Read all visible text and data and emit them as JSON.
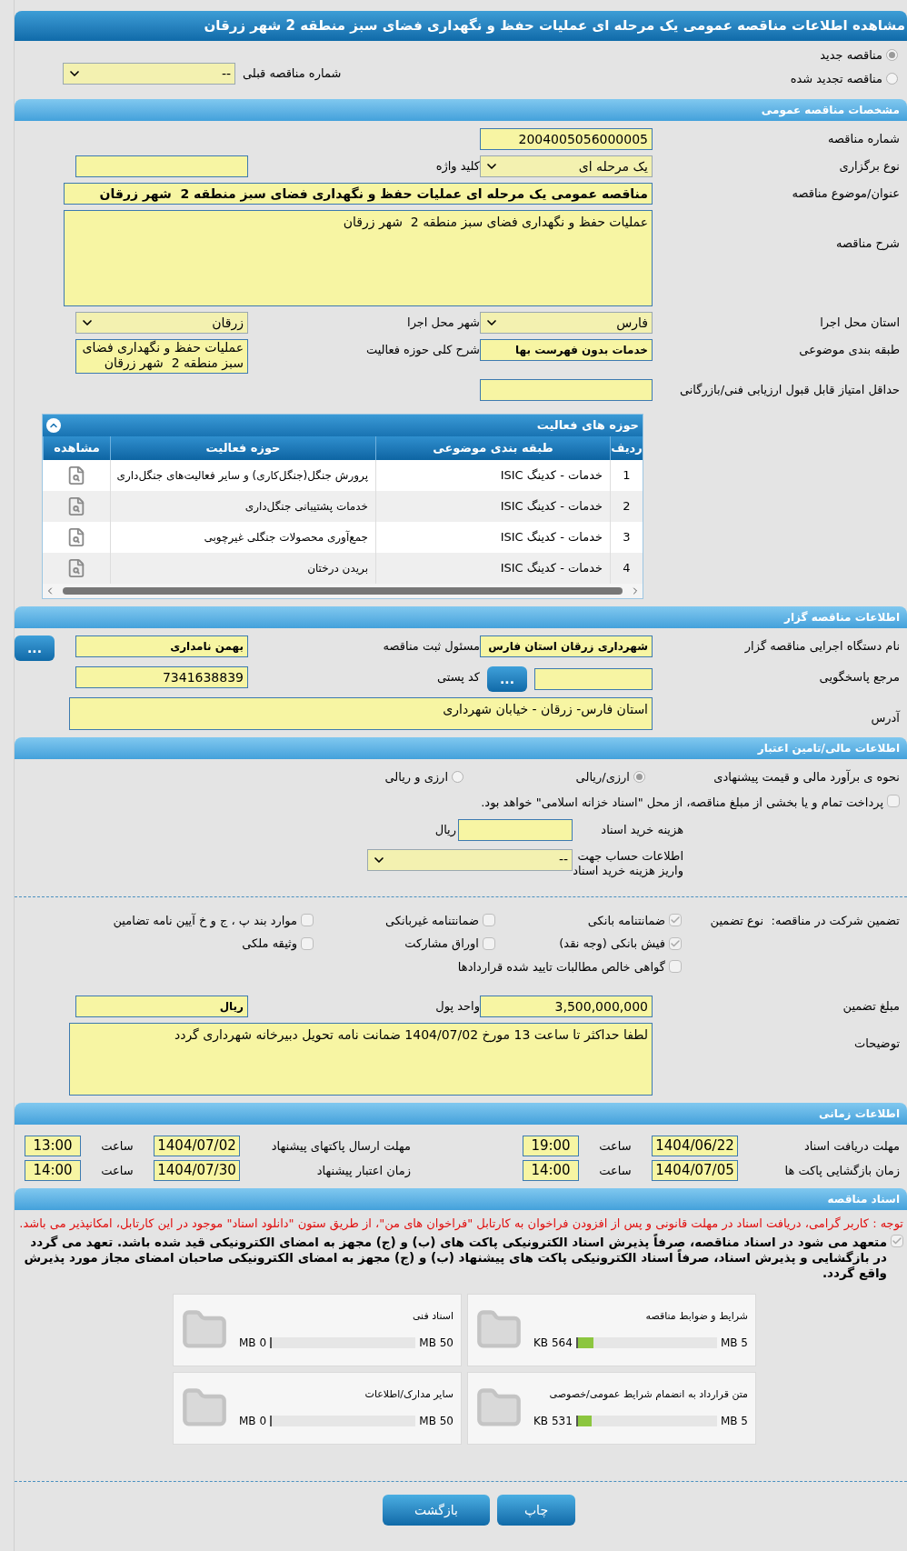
{
  "title": "مشاهده اطلاعات مناقصه عمومی یک مرحله ای عملیات حفظ و نگهداری فضای سبز منطقه 2 شهر زرقان",
  "tender_type": [
    {
      "label": "مناقصه جدید",
      "selected": true
    },
    {
      "label": "مناقصه تجدید شده",
      "selected": false
    }
  ],
  "previous_tender": {
    "label": "شماره مناقصه قبلی",
    "value": "--"
  },
  "general": {
    "heading": "مشخصات مناقصه عمومی",
    "rows": [
      [
        {
          "label": "شماره مناقصه",
          "kind": "input",
          "value": "2004005056000005",
          "bold": false
        }
      ],
      [
        {
          "label": "نوع برگزاری",
          "kind": "select",
          "value": "یک مرحله ای",
          "bold": false
        },
        {
          "label": "کلید واژه",
          "kind": "input"
        }
      ],
      [
        {
          "label": "عنوان/موضوع مناقصه",
          "kind": "wide",
          "value": "مناقصه عمومی یک مرحله ای عملیات حفظ و نگهداری فضای سبز منطقه 2  شهر زرقان",
          "bold": true
        }
      ],
      [
        {
          "label": "شرح مناقصه",
          "kind": "wide_area",
          "value": "عملیات حفظ و نگهداری فضای سبز منطقه 2  شهر زرقان",
          "bold": false
        }
      ],
      [
        {
          "label": "استان محل اجرا",
          "kind": "select",
          "value": "فارس",
          "bold": false
        },
        {
          "label": "شهر محل اجرا",
          "kind": "select",
          "value": "زرقان",
          "bold": false
        }
      ],
      [
        {
          "label": "طبقه بندی موضوعی",
          "kind": "input",
          "value": "خدمات بدون فهرست بها",
          "bold": true
        },
        {
          "label": "شرح کلی حوزه فعالیت",
          "kind": "note",
          "value": "عملیات حفظ و نگهداری فضای سبز منطقه 2  شهر زرقان",
          "bold": false
        }
      ],
      [
        {
          "label": "حداقل امتیاز قابل قبول ارزیابی فنی/بازرگانی",
          "kind": "input"
        }
      ]
    ]
  },
  "activities": {
    "heading": "حوزه های فعالیت",
    "columns": [
      "ردیف",
      "طبقه بندی موضوعی",
      "حوزه فعالیت",
      "مشاهده"
    ],
    "rows": [
      {
        "number": "1",
        "category": "خدمات - کدینگ ISIC",
        "activity": "پرورش جنگل(جنگل‌کاری) و سایر فعالیت‌های جنگل‌داری"
      },
      {
        "number": "2",
        "category": "خدمات - کدینگ ISIC",
        "activity": "خدمات پشتیبانی جنگل‌داری"
      },
      {
        "number": "3",
        "category": "خدمات - کدینگ ISIC",
        "activity": "جمع‌آوری محصولات جنگلی غیرچوبی"
      },
      {
        "number": "4",
        "category": "خدمات - کدینگ ISIC",
        "activity": "بریدن درختان"
      }
    ]
  },
  "organizer": {
    "heading": "اطلاعات مناقصه گزار",
    "rows": [
      [
        {
          "label": "نام دستگاه اجرایی مناقصه گزار",
          "kind": "input",
          "value": "شهرداری زرقان استان فارس",
          "bold": true
        },
        {
          "label": "مسئول ثبت مناقصه",
          "kind": "input",
          "value": "بهمن نامداری",
          "bold": true,
          "button": "..."
        }
      ],
      [
        {
          "label": "مرجع پاسخگویی",
          "kind": "input",
          "button": "..."
        },
        {
          "label": "کد پستی",
          "kind": "input",
          "value": "7341638839",
          "bold": false
        }
      ],
      [
        {
          "label": "آدرس",
          "kind": "wide_area",
          "value": "استان فارس- زرقان - خیابان شهرداری",
          "bold": false
        }
      ]
    ]
  },
  "finance": {
    "heading": "اطلاعات مالی/تامین اعتبار",
    "estimate": {
      "label": "نحوه ی برآورد مالی و قیمت پیشنهادی",
      "options": [
        {
          "label": "ارزی/ریالی",
          "selected": true
        },
        {
          "label": "ارزی و ریالی",
          "selected": false
        }
      ]
    },
    "treasury": {
      "label": "پرداخت تمام و یا بخشی از مبلغ مناقصه، از محل \"اسناد خزانه اسلامی\" خواهد بود.",
      "checked": false
    },
    "doc_fee": {
      "label": "هزینه خرید اسناد",
      "unit": "ریال"
    },
    "account": {
      "label": "اطلاعات حساب جهت واریز هزینه خرید اسناد",
      "value": "--"
    }
  },
  "guarantee": {
    "label": "تضمین شرکت در مناقصه:",
    "type_label": "نوع تضمین",
    "options": [
      {
        "label": "ضمانتنامه بانکی",
        "checked": true
      },
      {
        "label": "ضمانتنامه غیربانکی",
        "checked": false
      },
      {
        "label": "موارد بند پ ، ج و خ آیین نامه تضامین",
        "checked": false
      },
      {
        "label": "فیش بانکی (وجه نقد)",
        "checked": true
      },
      {
        "label": "اوراق مشارکت",
        "checked": false
      },
      {
        "label": "وثیقه ملکی",
        "checked": false
      },
      {
        "label": "گواهی خالص مطالبات تایید شده قراردادها",
        "checked": false
      }
    ],
    "rows": [
      [
        {
          "label": "مبلغ تضمین",
          "kind": "input",
          "value": "3,500,000,000",
          "bold": false
        },
        {
          "label": "واحد پول",
          "kind": "input",
          "value": "ریال",
          "bold": true
        }
      ],
      [
        {
          "label": "توضیحات",
          "kind": "wide_area",
          "value": "لطفا حداکثر تا ساعت 13 مورخ 1404/07/02 ضمانت نامه تحویل دبیرخانه شهرداری گردد",
          "bold": false
        }
      ]
    ]
  },
  "timing": {
    "heading": "اطلاعات زمانی",
    "items": [
      {
        "label": "مهلت دریافت اسناد",
        "date": "1404/06/22",
        "time_label": "ساعت",
        "time": "19:00"
      },
      {
        "label": "مهلت ارسال پاکتهای پیشنهاد",
        "date": "1404/07/02",
        "time_label": "ساعت",
        "time": "13:00"
      },
      {
        "label": "زمان بازگشایی پاکت ها",
        "date": "1404/07/05",
        "time_label": "ساعت",
        "time": "14:00"
      },
      {
        "label": "زمان اعتبار پیشنهاد",
        "date": "1404/07/30",
        "time_label": "ساعت",
        "time": "14:00"
      }
    ]
  },
  "documents": {
    "heading": "اسناد مناقصه",
    "notice": "توجه : کاربر گرامی، دریافت اسناد در مهلت قانونی و پس از افزودن فراخوان به کارتابل \"فراخوان های من\"، از طریق ستون \"دانلود اسناد\" موجود در این کارتابل، امکانپذیر می باشد.",
    "commitment": {
      "label": "متعهد می شود در اسناد مناقصه، صرفاً پذیرش اسناد الکترونیکی پاکت های (ب) و (ج) مجهز به امضای الکترونیکی قید شده باشد. تعهد می گردد در بازگشایی و پذیرش اسناد، صرفاً اسناد الکترونیکی پاکت های پیشنهاد (ب) و (ج) مجهز به امضای الکترونیکی صاحبان امضای مجاز مورد پذیرش واقع گردد.",
      "checked": true
    },
    "files": [
      {
        "name": "شرایط و ضوابط مناقصه",
        "size": "564 KB",
        "limit": "5 MB",
        "level": 0.11
      },
      {
        "name": "اسناد فنی",
        "size": "0 MB",
        "limit": "50 MB",
        "level": 0
      },
      {
        "name": "متن قرارداد به انضمام شرایط عمومی/خصوصی",
        "size": "531 KB",
        "limit": "5 MB",
        "level": 0.1
      },
      {
        "name": "سایر مدارک/اطلاعات",
        "size": "0 MB",
        "limit": "50 MB",
        "level": 0
      }
    ]
  },
  "buttons": [
    "چاپ",
    "بازگشت"
  ]
}
